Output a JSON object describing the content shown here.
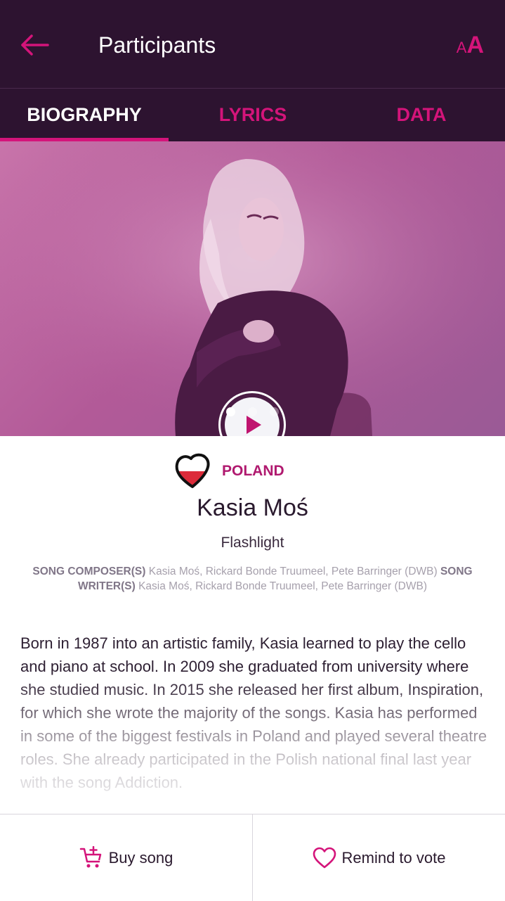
{
  "header": {
    "title": "Participants",
    "back_icon": "arrow-left-icon",
    "font_small": "A",
    "font_big": "A"
  },
  "tabs": [
    {
      "label": "BIOGRAPHY",
      "active": true
    },
    {
      "label": "LYRICS",
      "active": false
    },
    {
      "label": "DATA",
      "active": false
    }
  ],
  "media": {
    "play_icon": "play-icon",
    "slides_total": 3,
    "slide_active": 1
  },
  "participant": {
    "country": "POLAND",
    "artist": "Kasia Moś",
    "song": "Flashlight",
    "composer_label": "SONG COMPOSER(S)",
    "composers": "Kasia Moś, Rickard Bonde Truumeel, Pete Barringer (DWB)",
    "writer_label_1": "SONG",
    "writer_label_2": "WRITER(S)",
    "writers": "Kasia Moś, Rickard Bonde Truumeel, Pete Barringer (DWB)",
    "bio": "Born in 1987 into an artistic family, Kasia learned to play the cello and piano at school. In 2009 she graduated from university where she studied music. In 2015 she released her first album, Inspiration, for which she wrote the majority of the songs. Kasia has performed in some of the biggest festivals in Poland and played several theatre roles. She already participated in the Polish national final last year with the song Addiction."
  },
  "actions": {
    "buy_label": "Buy song",
    "remind_label": "Remind to vote"
  },
  "colors": {
    "header_bg": "#2d1330",
    "accent": "#d4147a",
    "hero_tint": "#b25a98"
  }
}
